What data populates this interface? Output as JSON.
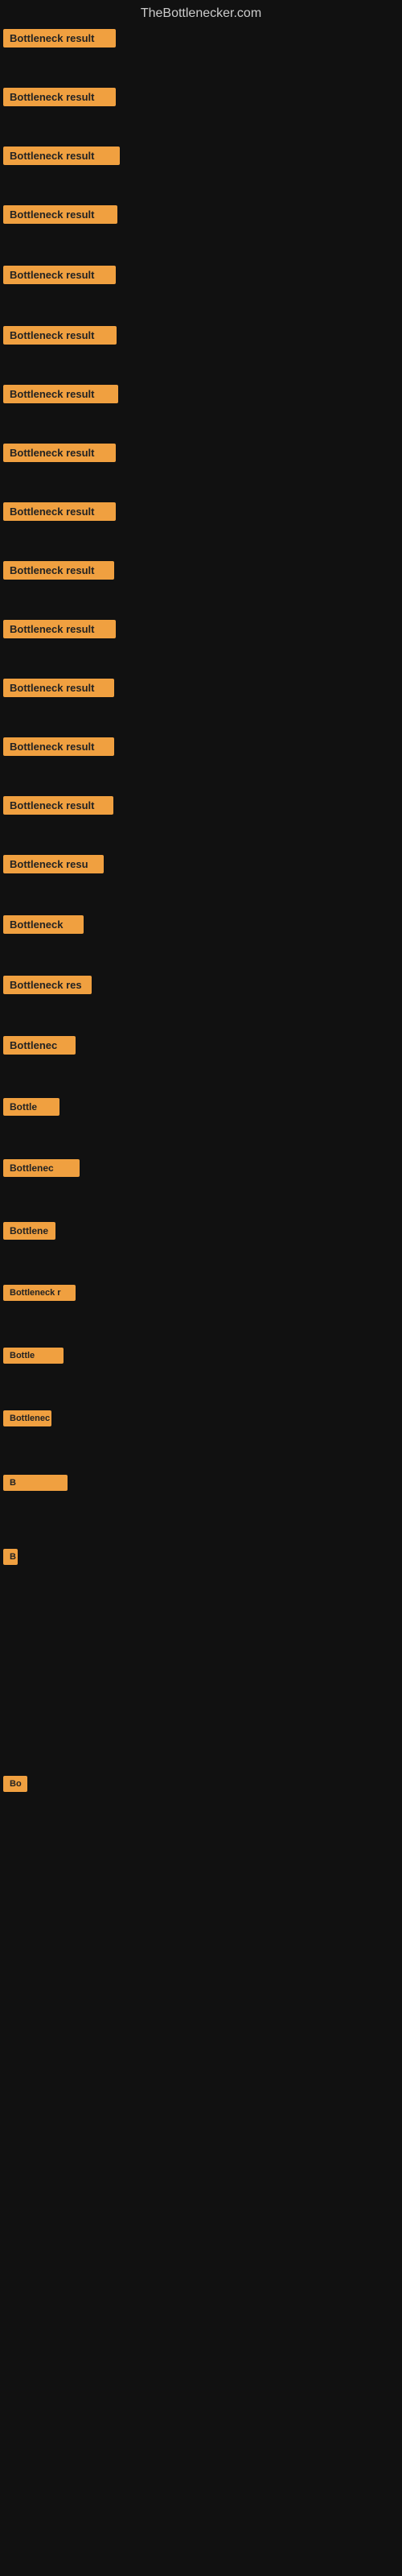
{
  "site": {
    "title": "TheBottlenecker.com"
  },
  "rows": [
    {
      "id": 1,
      "label": "Bottleneck result",
      "rowClass": "row-1"
    },
    {
      "id": 2,
      "label": "Bottleneck result",
      "rowClass": "row-2"
    },
    {
      "id": 3,
      "label": "Bottleneck result",
      "rowClass": "row-3"
    },
    {
      "id": 4,
      "label": "Bottleneck result",
      "rowClass": "row-4"
    },
    {
      "id": 5,
      "label": "Bottleneck result",
      "rowClass": "row-5"
    },
    {
      "id": 6,
      "label": "Bottleneck result",
      "rowClass": "row-6"
    },
    {
      "id": 7,
      "label": "Bottleneck result",
      "rowClass": "row-7"
    },
    {
      "id": 8,
      "label": "Bottleneck result",
      "rowClass": "row-8"
    },
    {
      "id": 9,
      "label": "Bottleneck result",
      "rowClass": "row-9"
    },
    {
      "id": 10,
      "label": "Bottleneck result",
      "rowClass": "row-10"
    },
    {
      "id": 11,
      "label": "Bottleneck result",
      "rowClass": "row-11"
    },
    {
      "id": 12,
      "label": "Bottleneck result",
      "rowClass": "row-12"
    },
    {
      "id": 13,
      "label": "Bottleneck result",
      "rowClass": "row-13"
    },
    {
      "id": 14,
      "label": "Bottleneck result",
      "rowClass": "row-14"
    },
    {
      "id": 15,
      "label": "Bottleneck resu",
      "rowClass": "row-15"
    },
    {
      "id": 16,
      "label": "Bottleneck",
      "rowClass": "row-16"
    },
    {
      "id": 17,
      "label": "Bottleneck res",
      "rowClass": "row-17"
    },
    {
      "id": 18,
      "label": "Bottlenec",
      "rowClass": "row-18"
    },
    {
      "id": 19,
      "label": "Bottle",
      "rowClass": "row-19"
    },
    {
      "id": 20,
      "label": "Bottlenec",
      "rowClass": "row-20"
    },
    {
      "id": 21,
      "label": "Bottlene",
      "rowClass": "row-21"
    },
    {
      "id": 22,
      "label": "Bottleneck r",
      "rowClass": "row-22"
    },
    {
      "id": 23,
      "label": "Bottle",
      "rowClass": "row-23"
    },
    {
      "id": 24,
      "label": "Bottlenec",
      "rowClass": "row-24"
    },
    {
      "id": 25,
      "label": "B",
      "rowClass": "row-25"
    },
    {
      "id": 26,
      "label": "B",
      "rowClass": "row-26"
    },
    {
      "id": 27,
      "label": "Bo",
      "rowClass": "row-last"
    }
  ],
  "colors": {
    "background": "#111111",
    "badge_bg": "#f0a040",
    "badge_text": "#222222",
    "site_title": "#cccccc"
  }
}
